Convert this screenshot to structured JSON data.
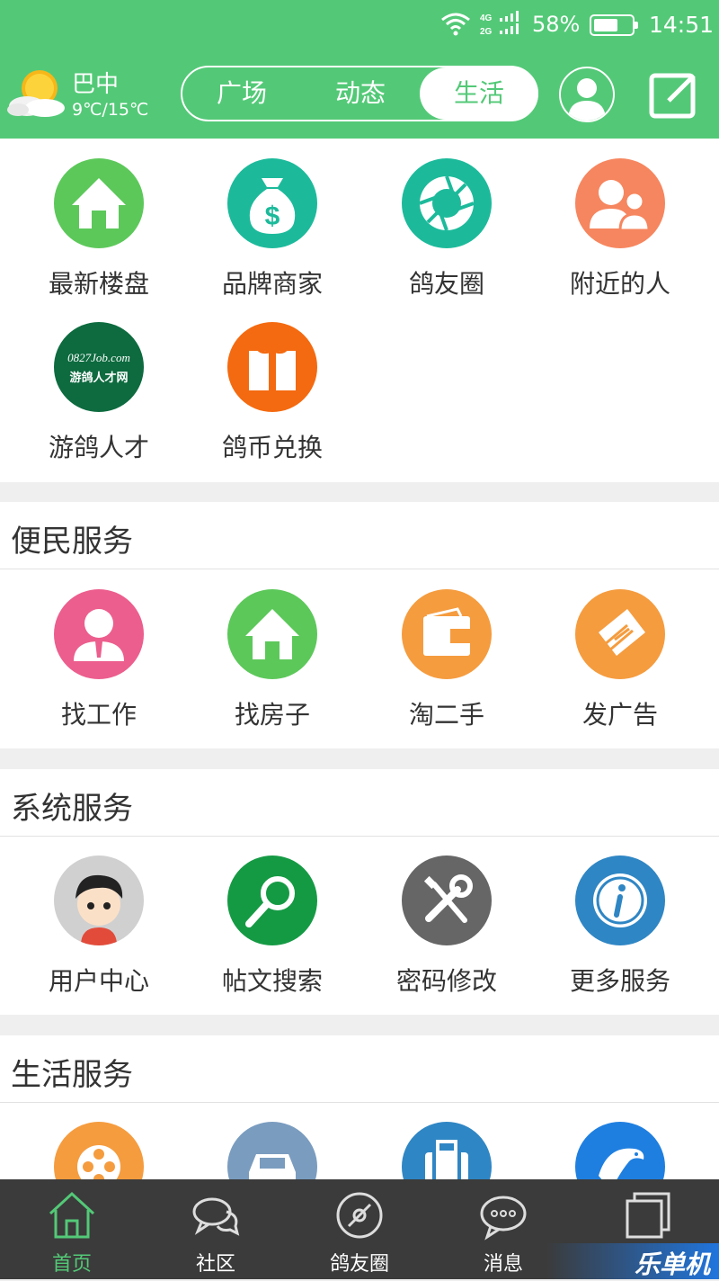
{
  "status_bar": {
    "network": "4G 2G",
    "battery": "58%",
    "time": "14:51"
  },
  "header": {
    "weather": {
      "city": "巴中",
      "temperature": "9℃/15℃",
      "icon": "partly-cloudy-icon"
    },
    "tabs": [
      {
        "label": "广场",
        "active": false
      },
      {
        "label": "动态",
        "active": false
      },
      {
        "label": "生活",
        "active": true
      }
    ],
    "profile_icon": "user-avatar-icon",
    "edit_icon": "edit-icon"
  },
  "quick_grid": {
    "items": [
      {
        "label": "最新楼盘",
        "icon": "house-icon",
        "color": "#5cc85a"
      },
      {
        "label": "品牌商家",
        "icon": "money-bag-icon",
        "color": "#1cba9b"
      },
      {
        "label": "鸽友圈",
        "icon": "aperture-icon",
        "color": "#1cba9b"
      },
      {
        "label": "附近的人",
        "icon": "people-icon",
        "color": "#f6865f"
      },
      {
        "label": "游鸽人才",
        "icon": "job-logo-icon",
        "color": "#0d6b3f",
        "logo_top": "0827Job.com",
        "logo_bottom": "游鸽人才网"
      },
      {
        "label": "鸽币兑换",
        "icon": "gift-icon",
        "color": "#f46a10"
      }
    ]
  },
  "sections": [
    {
      "title": "便民服务",
      "items": [
        {
          "label": "找工作",
          "icon": "businessman-icon",
          "color": "#ec5e8d"
        },
        {
          "label": "找房子",
          "icon": "house-icon",
          "color": "#5cc85a"
        },
        {
          "label": "淘二手",
          "icon": "wallet-icon",
          "color": "#f59c3f"
        },
        {
          "label": "发广告",
          "icon": "newspaper-icon",
          "color": "#f59c3f"
        }
      ]
    },
    {
      "title": "系统服务",
      "items": [
        {
          "label": "用户中心",
          "icon": "cartoon-avatar-icon",
          "color": "#d0d0d0"
        },
        {
          "label": "帖文搜索",
          "icon": "search-icon",
          "color": "#159a44"
        },
        {
          "label": "密码修改",
          "icon": "tools-icon",
          "color": "#666666"
        },
        {
          "label": "更多服务",
          "icon": "info-icon",
          "color": "#2f86c4"
        }
      ]
    },
    {
      "title": "生活服务",
      "items": [
        {
          "label": "",
          "icon": "film-reel-icon",
          "color": "#f59c3f"
        },
        {
          "label": "",
          "icon": "car-icon",
          "color": "#7a9cbf"
        },
        {
          "label": "",
          "icon": "luggage-icon",
          "color": "#2f86c4"
        },
        {
          "label": "",
          "icon": "dolphin-icon",
          "color": "#1f7fe0"
        }
      ]
    }
  ],
  "bottom_nav": [
    {
      "label": "首页",
      "icon": "home-icon",
      "active": true
    },
    {
      "label": "社区",
      "icon": "chat-bubbles-icon",
      "active": false
    },
    {
      "label": "鸽友圈",
      "icon": "disc-icon",
      "active": false
    },
    {
      "label": "消息",
      "icon": "message-icon",
      "active": false
    },
    {
      "label": "",
      "icon": "windows-icon",
      "active": false
    }
  ],
  "watermark": "乐单机",
  "colors": {
    "brand_green": "#53c977",
    "nav_background": "#3b3b3b"
  }
}
